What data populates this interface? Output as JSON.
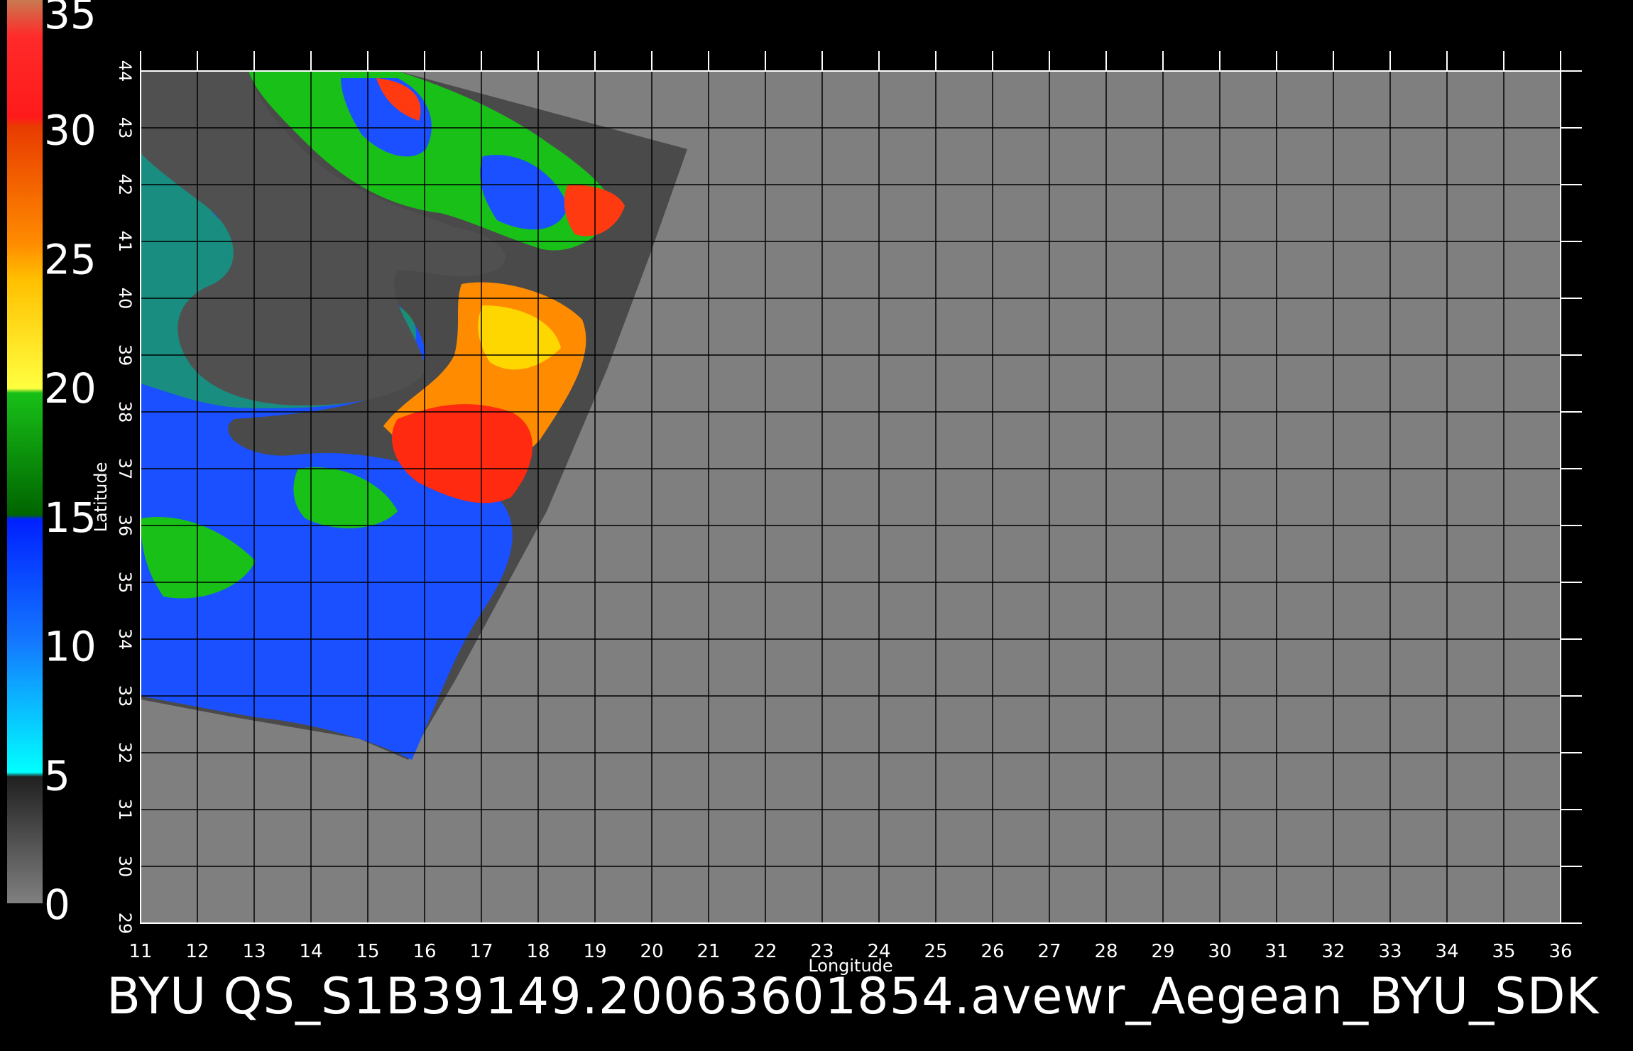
{
  "title": "BYU QS_S1B39149.20063601854.avewr_Aegean_BYU_SDK",
  "axes": {
    "xlabel": "Longitude",
    "ylabel": "Latitude",
    "lon_range": [
      11,
      36
    ],
    "lat_range": [
      29,
      44
    ],
    "lon_ticks": [
      "11",
      "12",
      "13",
      "14",
      "15",
      "16",
      "17",
      "18",
      "19",
      "20",
      "21",
      "22",
      "23",
      "24",
      "25",
      "26",
      "27",
      "28",
      "29",
      "30",
      "31",
      "32",
      "33",
      "34",
      "35",
      "36"
    ],
    "lat_ticks": [
      "29",
      "30",
      "31",
      "32",
      "33",
      "34",
      "35",
      "36",
      "37",
      "38",
      "39",
      "40",
      "41",
      "42",
      "43",
      "44"
    ],
    "grid": true
  },
  "colorbar": {
    "labels": [
      "35",
      "30",
      "25",
      "20",
      "15",
      "10",
      "5",
      "0"
    ],
    "range": [
      0,
      35
    ],
    "stops": [
      {
        "value": 35,
        "color": "#c87a50"
      },
      {
        "value": 33,
        "color": "#ff1a1a"
      },
      {
        "value": 28,
        "color": "#e83b00"
      },
      {
        "value": 25,
        "color": "#ff8c00"
      },
      {
        "value": 22,
        "color": "#ffd700"
      },
      {
        "value": 20,
        "color": "#ffff40"
      },
      {
        "value": 19,
        "color": "#18c018"
      },
      {
        "value": 15,
        "color": "#006400"
      },
      {
        "value": 14.9,
        "color": "#0020ff"
      },
      {
        "value": 10,
        "color": "#1478ff"
      },
      {
        "value": 5.1,
        "color": "#00ffff"
      },
      {
        "value": 5,
        "color": "#202020"
      },
      {
        "value": 0,
        "color": "#808080"
      }
    ]
  },
  "colors": {
    "background": "#000000",
    "map_fill": "#7f7f7f",
    "swath_dark": "#4a4a4a",
    "land": "#505050"
  }
}
